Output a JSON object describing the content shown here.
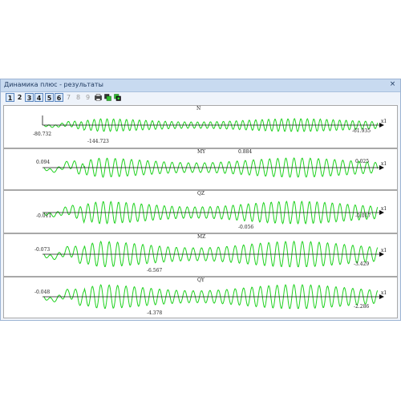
{
  "window": {
    "title": "Динамика плюс - результаты",
    "close_glyph": "×"
  },
  "toolbar": {
    "tabs": [
      {
        "label": "1",
        "state": "active"
      },
      {
        "label": "2",
        "state": "normal"
      },
      {
        "label": "3",
        "state": "active"
      },
      {
        "label": "4",
        "state": "active"
      },
      {
        "label": "5",
        "state": "active"
      },
      {
        "label": "6",
        "state": "active"
      },
      {
        "label": "7",
        "state": "disabled"
      },
      {
        "label": "8",
        "state": "disabled"
      },
      {
        "label": "9",
        "state": "disabled"
      }
    ],
    "icons": [
      "print-icon",
      "copy-icon",
      "export-icon"
    ]
  },
  "colors": {
    "signal": "#1fd21f",
    "axis": "#111111",
    "panel_border": "#a8a8a8"
  },
  "plots": [
    {
      "name": "N",
      "left_value": "-80.732",
      "right_value": "-61.935",
      "min_label": "-144.723",
      "max_label": "",
      "axis_label": "x1"
    },
    {
      "name": "MY",
      "left_value": "0.094",
      "right_value": "0.025",
      "min_label": "",
      "max_label": "0.884",
      "axis_label": "x1"
    },
    {
      "name": "QZ",
      "left_value": "-0.011",
      "right_value": "-0.017",
      "min_label": "-0.056",
      "max_label": "",
      "axis_label": "x1"
    },
    {
      "name": "MZ",
      "left_value": "-0.073",
      "right_value": "-3.429",
      "min_label": "-6.567",
      "max_label": "",
      "axis_label": "x1"
    },
    {
      "name": "QY",
      "left_value": "-0.048",
      "right_value": "-2.286",
      "min_label": "-4.378",
      "max_label": "",
      "axis_label": "x1"
    }
  ]
}
